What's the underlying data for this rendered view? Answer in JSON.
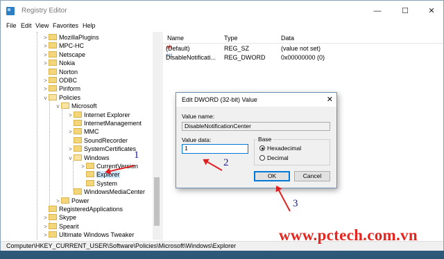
{
  "window": {
    "title": "Registry Editor",
    "controls": {
      "minimize": "—",
      "maximize": "☐",
      "close": "✕"
    }
  },
  "menu": [
    "File",
    "Edit",
    "View",
    "Favorites",
    "Help"
  ],
  "tree": {
    "items": [
      {
        "label": "MozillaPlugins",
        "expander": ">"
      },
      {
        "label": "MPC-HC",
        "expander": ">"
      },
      {
        "label": "Netscape",
        "expander": ">"
      },
      {
        "label": "Nokia",
        "expander": ">"
      },
      {
        "label": "Norton",
        "expander": ""
      },
      {
        "label": "ODBC",
        "expander": ">"
      },
      {
        "label": "Piriform",
        "expander": ">"
      },
      {
        "label": "Policies",
        "expander": "v"
      },
      {
        "label": "Microsoft",
        "expander": "v"
      },
      {
        "label": "Internet Explorer",
        "expander": ">"
      },
      {
        "label": "InternetManagement",
        "expander": ""
      },
      {
        "label": "MMC",
        "expander": ">"
      },
      {
        "label": "SoundRecorder",
        "expander": ""
      },
      {
        "label": "SystemCertificates",
        "expander": ">"
      },
      {
        "label": "Windows",
        "expander": "v"
      },
      {
        "label": "CurrentVersion",
        "expander": ">"
      },
      {
        "label": "Explorer",
        "expander": ""
      },
      {
        "label": "System",
        "expander": ""
      },
      {
        "label": "WindowsMediaCenter",
        "expander": ""
      },
      {
        "label": "Power",
        "expander": ">"
      },
      {
        "label": "RegisteredApplications",
        "expander": ""
      },
      {
        "label": "Skype",
        "expander": ">"
      },
      {
        "label": "Spearit",
        "expander": ">"
      },
      {
        "label": "Ultimate Windows Tweaker",
        "expander": ">"
      }
    ]
  },
  "list": {
    "headers": {
      "name": "Name",
      "type": "Type",
      "data": "Data"
    },
    "rows": [
      {
        "icon": "ab",
        "name": "(Default)",
        "type": "REG_SZ",
        "data": "(value not set)"
      },
      {
        "icon": "011",
        "name": "DisableNotificati...",
        "type": "REG_DWORD",
        "data": "0x00000000 (0)"
      }
    ]
  },
  "status": "Computer\\HKEY_CURRENT_USER\\Software\\Policies\\Microsoft\\Windows\\Explorer",
  "dialog": {
    "title": "Edit DWORD (32-bit) Value",
    "close": "✕",
    "value_name_label": "Value name:",
    "value_name": "DisableNotificationCenter",
    "value_data_label": "Value data:",
    "value_data": "1",
    "base_label": "Base",
    "base_options": [
      "Hexadecimal",
      "Decimal"
    ],
    "ok": "OK",
    "cancel": "Cancel"
  },
  "annotations": {
    "step1": "1",
    "step2": "2",
    "step3": "3"
  },
  "watermark": "www.pctech.com.vn",
  "colors": {
    "arrow": "#e02020",
    "watermark": "#e3261f",
    "step_numbers": "#1a1a9a"
  }
}
